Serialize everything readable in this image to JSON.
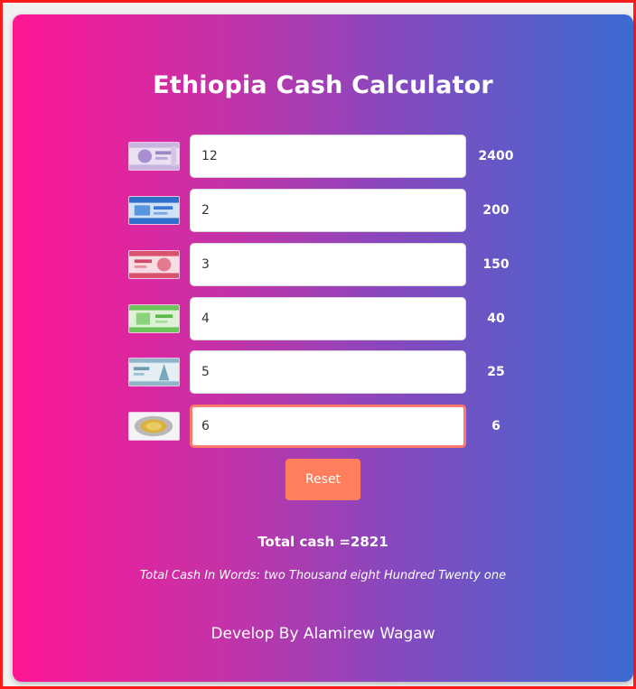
{
  "app": {
    "title": "Ethiopia Cash Calculator"
  },
  "denominations": [
    {
      "icon": "birr-200-note-icon",
      "quantity": "12",
      "subtotal": "2400",
      "color": "#b9a6d6"
    },
    {
      "icon": "birr-100-note-icon",
      "quantity": "2",
      "subtotal": "200",
      "color": "#3f7fd6"
    },
    {
      "icon": "birr-50-note-icon",
      "quantity": "3",
      "subtotal": "150",
      "color": "#e0627a"
    },
    {
      "icon": "birr-10-note-icon",
      "quantity": "4",
      "subtotal": "40",
      "color": "#7ccf6a"
    },
    {
      "icon": "birr-5-note-icon",
      "quantity": "5",
      "subtotal": "25",
      "color": "#8fb6c9"
    },
    {
      "icon": "birr-1-coin-icon",
      "quantity": "6",
      "subtotal": "6",
      "color": "#d6b43a"
    }
  ],
  "actions": {
    "reset_label": "Reset"
  },
  "summary": {
    "total_text": "Total cash =2821",
    "words_text": "Total Cash In Words: two Thousand eight Hundred Twenty one"
  },
  "footer": {
    "credit": "Develop By Alamirew Wagaw"
  },
  "colors": {
    "gradient_start": "#ff1694",
    "gradient_end": "#3a6bd2",
    "reset_button": "#ff7f5c",
    "focus_border": "#ff7a6a"
  }
}
